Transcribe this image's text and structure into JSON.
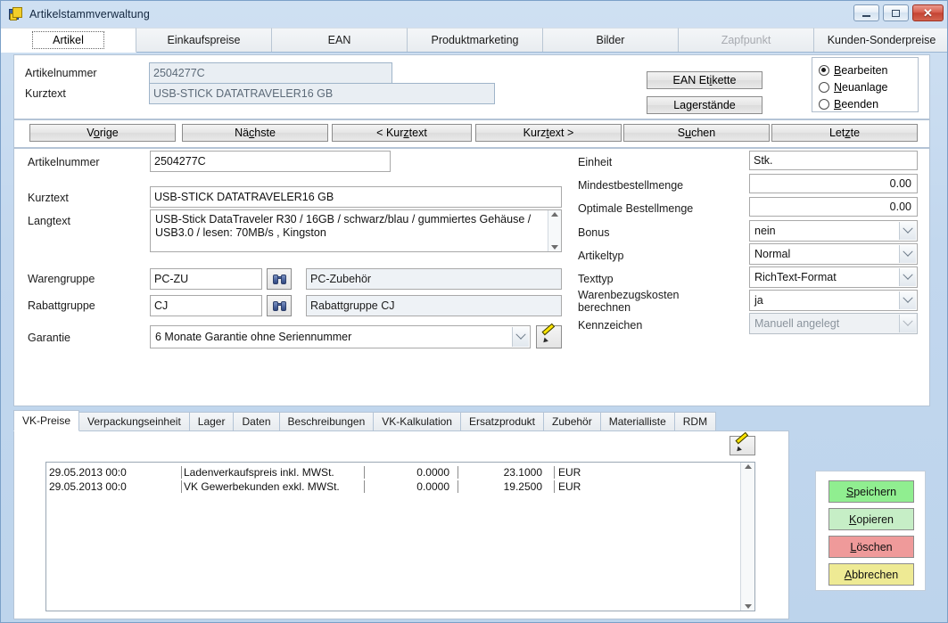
{
  "window": {
    "title": "Artikelstammverwaltung",
    "icon": "app-article-icon",
    "minimize_label": "–",
    "maximize_label": "□",
    "close_label": "✕"
  },
  "top_tabs": [
    {
      "label": "Artikel",
      "active": true,
      "disabled": false
    },
    {
      "label": "Einkaufspreise",
      "active": false,
      "disabled": false
    },
    {
      "label": "EAN",
      "active": false,
      "disabled": false
    },
    {
      "label": "Produktmarketing",
      "active": false,
      "disabled": false
    },
    {
      "label": "Bilder",
      "active": false,
      "disabled": false
    },
    {
      "label": "Zapfpunkt",
      "active": false,
      "disabled": true
    },
    {
      "label": "Kunden-Sonderpreise",
      "active": false,
      "disabled": false
    }
  ],
  "header": {
    "artikelnummer_label": "Artikelnummer",
    "artikelnummer_value": "2504277C",
    "kurztext_label": "Kurztext",
    "kurztext_value": "USB-STICK DATATRAVELER16 GB",
    "ean_button": "EAN Etikette",
    "lager_button": "Lagerstände"
  },
  "mode_radios": [
    {
      "label": "Bearbeiten",
      "accel": "B",
      "selected": true
    },
    {
      "label": "Neuanlage",
      "accel": "N",
      "selected": false
    },
    {
      "label": "Beenden",
      "accel": "B",
      "selected": false
    }
  ],
  "nav_buttons": [
    {
      "label": "Vorige",
      "accel": "o"
    },
    {
      "label": "Nächste",
      "accel": "c"
    },
    {
      "label": "< Kurztext",
      "accel": "z"
    },
    {
      "label": "Kurztext >",
      "accel": "t"
    },
    {
      "label": "Suchen",
      "accel": "u"
    },
    {
      "label": "Letzte",
      "accel": "z"
    }
  ],
  "form_left": {
    "artikelnummer_label": "Artikelnummer",
    "artikelnummer_value": "2504277C",
    "kurztext_label": "Kurztext",
    "kurztext_value": "USB-STICK DATATRAVELER16 GB",
    "langtext_label": "Langtext",
    "langtext_value": "USB-Stick DataTraveler R30 / 16GB / schwarz/blau / gummiertes Gehäuse / USB3.0 / lesen: 70MB/s , Kingston",
    "warengruppe_label": "Warengruppe",
    "warengruppe_code": "PC-ZU",
    "warengruppe_text": "PC-Zubehör",
    "rabattgruppe_label": "Rabattgruppe",
    "rabattgruppe_code": "CJ",
    "rabattgruppe_text": "Rabattgruppe CJ",
    "garantie_label": "Garantie",
    "garantie_value": "6 Monate Garantie ohne Seriennummer"
  },
  "form_right": {
    "einheit_label": "Einheit",
    "einheit_value": "Stk.",
    "mindestbestellmenge_label": "Mindestbestellmenge",
    "mindestbestellmenge_value": "0.00",
    "optimale_bestellmenge_label": "Optimale Bestellmenge",
    "optimale_bestellmenge_value": "0.00",
    "bonus_label": "Bonus",
    "bonus_value": "nein",
    "artikeltyp_label": "Artikeltyp",
    "artikeltyp_value": "Normal",
    "texttyp_label": "Texttyp",
    "texttyp_value": "RichText-Format",
    "warenbezugskosten_label_1": "Warenbezugskosten",
    "warenbezugskosten_label_2": "berechnen",
    "warenbezugskosten_value": "ja",
    "kennzeichen_label": "Kennzeichen",
    "kennzeichen_value": "Manuell angelegt"
  },
  "lower_tabs": [
    {
      "label": "VK-Preise",
      "active": true
    },
    {
      "label": "Verpackungseinheit",
      "active": false
    },
    {
      "label": "Lager",
      "active": false
    },
    {
      "label": "Daten",
      "active": false
    },
    {
      "label": "Beschreibungen",
      "active": false
    },
    {
      "label": "VK-Kalkulation",
      "active": false
    },
    {
      "label": "Ersatzprodukt",
      "active": false
    },
    {
      "label": "Zubehör",
      "active": false
    },
    {
      "label": "Materialliste",
      "active": false
    },
    {
      "label": "RDM",
      "active": false
    }
  ],
  "price_table": {
    "rows": [
      {
        "date": "29.05.2013 00:0",
        "description": "Ladenverkaufspreis inkl. MWSt.",
        "value1": "0.0000",
        "value2": "23.1000",
        "currency": "EUR"
      },
      {
        "date": "29.05.2013 00:0",
        "description": "VK Gewerbekunden exkl. MWSt.",
        "value1": "0.0000",
        "value2": "19.2500",
        "currency": "EUR"
      }
    ]
  },
  "action_buttons": [
    {
      "label": "Speichern",
      "accel": "S",
      "color": "#90ee90"
    },
    {
      "label": "Kopieren",
      "accel": "K",
      "color": "#c6eec6"
    },
    {
      "label": "Löschen",
      "accel": "L",
      "color": "#ef9a9a"
    },
    {
      "label": "Abbrechen",
      "accel": "A",
      "color": "#eeea94"
    }
  ],
  "icons": {
    "search_binoculars": "binoculars-icon",
    "edit_pencil": "pencil-icon",
    "scroll_up": "chevron-up-icon",
    "scroll_down": "chevron-down-icon"
  }
}
